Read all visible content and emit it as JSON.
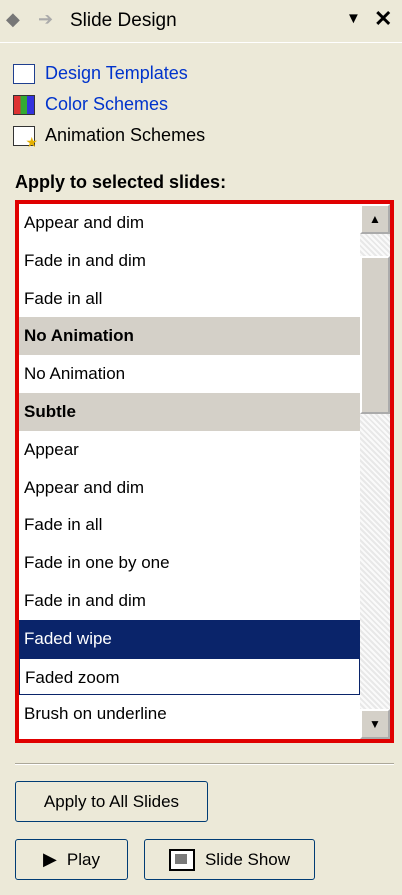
{
  "panel": {
    "back_icon": "back-arrow-icon",
    "forward_icon": "forward-arrow-icon",
    "title": "Slide Design",
    "dropdown_glyph": "▼",
    "close_glyph": "✕"
  },
  "links": [
    {
      "label": "Design Templates",
      "icon": "design-templates-icon"
    },
    {
      "label": "Color Schemes",
      "icon": "color-schemes-icon"
    },
    {
      "label": "Animation Schemes",
      "icon": "animation-schemes-icon"
    }
  ],
  "apply_label": "Apply to selected slides:",
  "list": {
    "items": [
      {
        "label": "Appear and dim",
        "kind": "item"
      },
      {
        "label": "Fade in and dim",
        "kind": "item"
      },
      {
        "label": "Fade in all",
        "kind": "item"
      },
      {
        "label": "No Animation",
        "kind": "header"
      },
      {
        "label": "No Animation",
        "kind": "item"
      },
      {
        "label": "Subtle",
        "kind": "header"
      },
      {
        "label": "Appear",
        "kind": "item"
      },
      {
        "label": "Appear and dim",
        "kind": "item"
      },
      {
        "label": "Fade in all",
        "kind": "item"
      },
      {
        "label": "Fade in one by one",
        "kind": "item"
      },
      {
        "label": "Fade in and dim",
        "kind": "item"
      },
      {
        "label": "Faded wipe",
        "kind": "selected"
      },
      {
        "label": "Faded zoom",
        "kind": "focused"
      },
      {
        "label": "Brush on underline",
        "kind": "item"
      }
    ]
  },
  "buttons": {
    "apply_all": "Apply to All Slides",
    "play": "Play",
    "slide_show": "Slide Show"
  },
  "colors": {
    "selection": "#0a246a",
    "highlight_border": "#e00000",
    "link": "#0033cc"
  }
}
